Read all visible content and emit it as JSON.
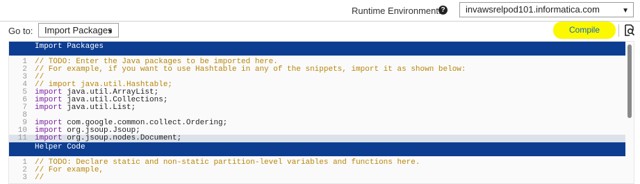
{
  "top": {
    "env_label": "Runtime Environment:",
    "env_required": "*",
    "help_glyph": "?",
    "env_value": "invawsrelpod101.informatica.com",
    "dropdown_caret": "▼"
  },
  "goto": {
    "label": "Go to:",
    "value": "Import Packages",
    "caret": "▼"
  },
  "compile_label": "Compile",
  "highlight_color": "#fbf800",
  "section_color": "#0d3d91",
  "sections": [
    {
      "title": "Import Packages",
      "lines": [
        {
          "num": "1",
          "segments": [
            {
              "t": "cmt",
              "text": "// TODO: Enter the Java packages to be imported here."
            }
          ]
        },
        {
          "num": "2",
          "segments": [
            {
              "t": "cmt",
              "text": "// For example, if you want to use Hashtable in any of the snippets, import it as shown below:"
            }
          ]
        },
        {
          "num": "3",
          "segments": [
            {
              "t": "cmt",
              "text": "//"
            }
          ]
        },
        {
          "num": "4",
          "segments": [
            {
              "t": "cmt",
              "text": "// import java.util.Hashtable;"
            }
          ]
        },
        {
          "num": "5",
          "segments": [
            {
              "t": "kw",
              "text": "import"
            },
            {
              "t": "txt",
              "text": " java.util.ArrayList;"
            }
          ]
        },
        {
          "num": "6",
          "segments": [
            {
              "t": "kw",
              "text": "import"
            },
            {
              "t": "txt",
              "text": " java.util.Collections;"
            }
          ]
        },
        {
          "num": "7",
          "segments": [
            {
              "t": "kw",
              "text": "import"
            },
            {
              "t": "txt",
              "text": " java.util.List;"
            }
          ]
        },
        {
          "num": "8",
          "segments": []
        },
        {
          "num": "9",
          "segments": [
            {
              "t": "kw",
              "text": "import"
            },
            {
              "t": "txt",
              "text": " com.google.common.collect.Ordering;"
            }
          ]
        },
        {
          "num": "10",
          "segments": [
            {
              "t": "kw",
              "text": "import"
            },
            {
              "t": "txt",
              "text": " org.jsoup.Jsoup;"
            }
          ]
        },
        {
          "num": "11",
          "active": true,
          "segments": [
            {
              "t": "kw",
              "text": "import"
            },
            {
              "t": "txt",
              "text": " org.jsoup.nodes.Document;"
            }
          ]
        }
      ]
    },
    {
      "title": "Helper Code",
      "lines": [
        {
          "num": "1",
          "segments": [
            {
              "t": "cmt",
              "text": "// TODO: Declare static and non-static partition-level variables and functions here."
            }
          ]
        },
        {
          "num": "2",
          "segments": [
            {
              "t": "cmt",
              "text": "// For example,"
            }
          ]
        },
        {
          "num": "3",
          "segments": [
            {
              "t": "cmt",
              "text": "//"
            }
          ]
        }
      ]
    }
  ],
  "icons": {
    "help": "question-circle-icon",
    "search_doc": "document-search-icon"
  }
}
